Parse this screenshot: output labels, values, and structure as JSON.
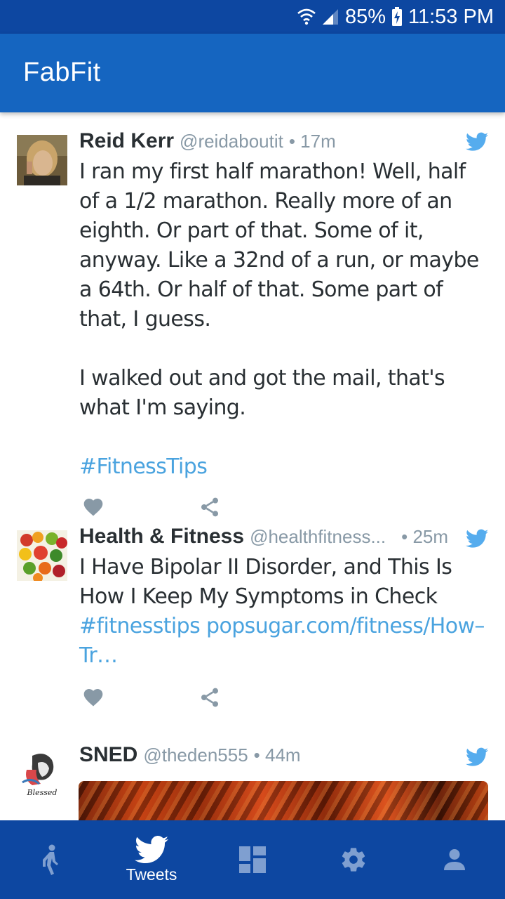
{
  "status_bar": {
    "battery": "85%",
    "time": "11:53 PM"
  },
  "app_bar": {
    "title": "FabFit"
  },
  "tweets": [
    {
      "author": "Reid Kerr",
      "handle": "@reidaboutit",
      "time": "• 17m",
      "paragraphs": [
        "I ran my first half marathon! Well, half of a 1/2 marathon. Really more of an eighth. Or part of that. Some of it, anyway. Like a 32nd of a run, or maybe a 64th. Or half of that. Some part of that, I guess.",
        "I walked out and got the mail, that's what I'm saying."
      ],
      "hashtag": "#FitnessTips"
    },
    {
      "author": "Health & Fitness",
      "handle": "@healthfitness...",
      "time": "• 25m",
      "text": "I Have Bipolar II Disorder, and This Is How I Keep My Symptoms in Check",
      "hashtag": "#fitnesstips",
      "link": "popsugar.com/fitness/How–Tr…"
    },
    {
      "author": "SNED",
      "handle": "@theden555",
      "time": "• 44m",
      "avatar_text": "Blessed"
    }
  ],
  "bottom_nav": {
    "items": [
      {
        "icon": "walking-person-icon"
      },
      {
        "icon": "twitter-bird-icon",
        "label": "Tweets"
      },
      {
        "icon": "dashboard-icon"
      },
      {
        "icon": "gear-icon"
      },
      {
        "icon": "person-icon"
      }
    ]
  },
  "colors": {
    "status_bar": "#0d47a1",
    "app_bar": "#1565c0",
    "bottom_nav": "#0d47a1",
    "link": "#4aa3df",
    "action_icon": "#8899a6",
    "twitter_blue": "#55acee"
  }
}
